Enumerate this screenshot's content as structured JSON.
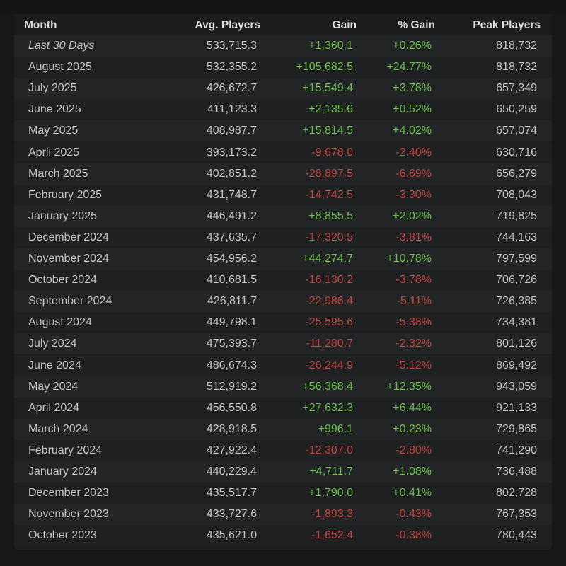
{
  "table": {
    "headers": {
      "month": "Month",
      "avg": "Avg. Players",
      "gain": "Gain",
      "pct": "% Gain",
      "peak": "Peak Players"
    },
    "rows": [
      {
        "month": "Last 30 Days",
        "avg": "533,715.3",
        "gain": "+1,360.1",
        "pct": "+0.26%",
        "peak": "818,732"
      },
      {
        "month": "August 2025",
        "avg": "532,355.2",
        "gain": "+105,682.5",
        "pct": "+24.77%",
        "peak": "818,732"
      },
      {
        "month": "July 2025",
        "avg": "426,672.7",
        "gain": "+15,549.4",
        "pct": "+3.78%",
        "peak": "657,349"
      },
      {
        "month": "June 2025",
        "avg": "411,123.3",
        "gain": "+2,135.6",
        "pct": "+0.52%",
        "peak": "650,259"
      },
      {
        "month": "May 2025",
        "avg": "408,987.7",
        "gain": "+15,814.5",
        "pct": "+4.02%",
        "peak": "657,074"
      },
      {
        "month": "April 2025",
        "avg": "393,173.2",
        "gain": "-9,678.0",
        "pct": "-2.40%",
        "peak": "630,716"
      },
      {
        "month": "March 2025",
        "avg": "402,851.2",
        "gain": "-28,897.5",
        "pct": "-6.69%",
        "peak": "656,279"
      },
      {
        "month": "February 2025",
        "avg": "431,748.7",
        "gain": "-14,742.5",
        "pct": "-3.30%",
        "peak": "708,043"
      },
      {
        "month": "January 2025",
        "avg": "446,491.2",
        "gain": "+8,855.5",
        "pct": "+2.02%",
        "peak": "719,825"
      },
      {
        "month": "December 2024",
        "avg": "437,635.7",
        "gain": "-17,320.5",
        "pct": "-3.81%",
        "peak": "744,163"
      },
      {
        "month": "November 2024",
        "avg": "454,956.2",
        "gain": "+44,274.7",
        "pct": "+10.78%",
        "peak": "797,599"
      },
      {
        "month": "October 2024",
        "avg": "410,681.5",
        "gain": "-16,130.2",
        "pct": "-3.78%",
        "peak": "706,726"
      },
      {
        "month": "September 2024",
        "avg": "426,811.7",
        "gain": "-22,986.4",
        "pct": "-5.11%",
        "peak": "726,385"
      },
      {
        "month": "August 2024",
        "avg": "449,798.1",
        "gain": "-25,595.6",
        "pct": "-5.38%",
        "peak": "734,381"
      },
      {
        "month": "July 2024",
        "avg": "475,393.7",
        "gain": "-11,280.7",
        "pct": "-2.32%",
        "peak": "801,126"
      },
      {
        "month": "June 2024",
        "avg": "486,674.3",
        "gain": "-26,244.9",
        "pct": "-5.12%",
        "peak": "869,492"
      },
      {
        "month": "May 2024",
        "avg": "512,919.2",
        "gain": "+56,368.4",
        "pct": "+12.35%",
        "peak": "943,059"
      },
      {
        "month": "April 2024",
        "avg": "456,550.8",
        "gain": "+27,632.3",
        "pct": "+6.44%",
        "peak": "921,133"
      },
      {
        "month": "March 2024",
        "avg": "428,918.5",
        "gain": "+996.1",
        "pct": "+0.23%",
        "peak": "729,865"
      },
      {
        "month": "February 2024",
        "avg": "427,922.4",
        "gain": "-12,307.0",
        "pct": "-2.80%",
        "peak": "741,290"
      },
      {
        "month": "January 2024",
        "avg": "440,229.4",
        "gain": "+4,711.7",
        "pct": "+1.08%",
        "peak": "736,488"
      },
      {
        "month": "December 2023",
        "avg": "435,517.7",
        "gain": "+1,790.0",
        "pct": "+0.41%",
        "peak": "802,728"
      },
      {
        "month": "November 2023",
        "avg": "433,727.6",
        "gain": "-1,893.3",
        "pct": "-0.43%",
        "peak": "767,353"
      },
      {
        "month": "October 2023",
        "avg": "435,621.0",
        "gain": "-1,652.4",
        "pct": "-0.38%",
        "peak": "780,443"
      }
    ]
  },
  "colors": {
    "positive": "#66c04a",
    "negative": "#c4423c"
  }
}
